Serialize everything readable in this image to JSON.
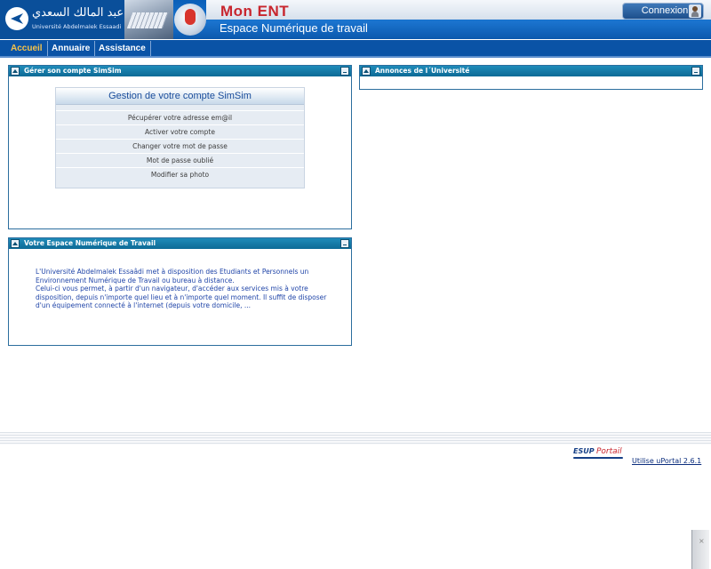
{
  "header": {
    "university_arabic": "جامعة عبد المالك السعدي",
    "university_latin": "Université AbdelmaIek Essaadi",
    "app_title": "Mon ENT",
    "app_subtitle": "Espace Numérique de travail",
    "login_label": "Connexion"
  },
  "nav": {
    "tabs": [
      {
        "label": "Accueil",
        "active": true
      },
      {
        "label": "Annuaire",
        "active": false
      },
      {
        "label": "Assistance",
        "active": false
      }
    ]
  },
  "panels": {
    "simsim": {
      "title": "Gérer son compte SimSim",
      "box_title": "Gestion de votre compte SimSim",
      "items": [
        "Pécupérer votre adresse em@il",
        "Activer votre compte",
        "Changer votre mot de passe",
        "Mot de passe oublié",
        "Modifier sa photo"
      ]
    },
    "ent": {
      "title": "Votre Espace Numérique de Travail",
      "body": "L'Université Abdelmalek Essaâdi met à disposition des Etudiants et Personnels un Environnement Numérique de Travail ou bureau à distance.\nCelui-ci vous permet, à partir d'un navigateur, d'accéder aux services mis à votre disposition, depuis n'importe quel lieu et à n'importe quel moment. Il suffit de disposer d'un équipement connecté à l'internet (depuis votre domicile, ..."
    },
    "annonces": {
      "title": "Annonces de l´Université"
    }
  },
  "footer": {
    "esup_part1": "ESUP",
    "esup_part2": "Portail",
    "uportal_link": "Utilise uPortal 2.6.1"
  },
  "side_widget": {
    "close_glyph": "×"
  },
  "colors": {
    "header_blue": "#0a5fb8",
    "title_red": "#c8262e",
    "active_tab": "#f5c24a",
    "panel_header": "#1f8bb9",
    "link_blue": "#2045a8"
  }
}
